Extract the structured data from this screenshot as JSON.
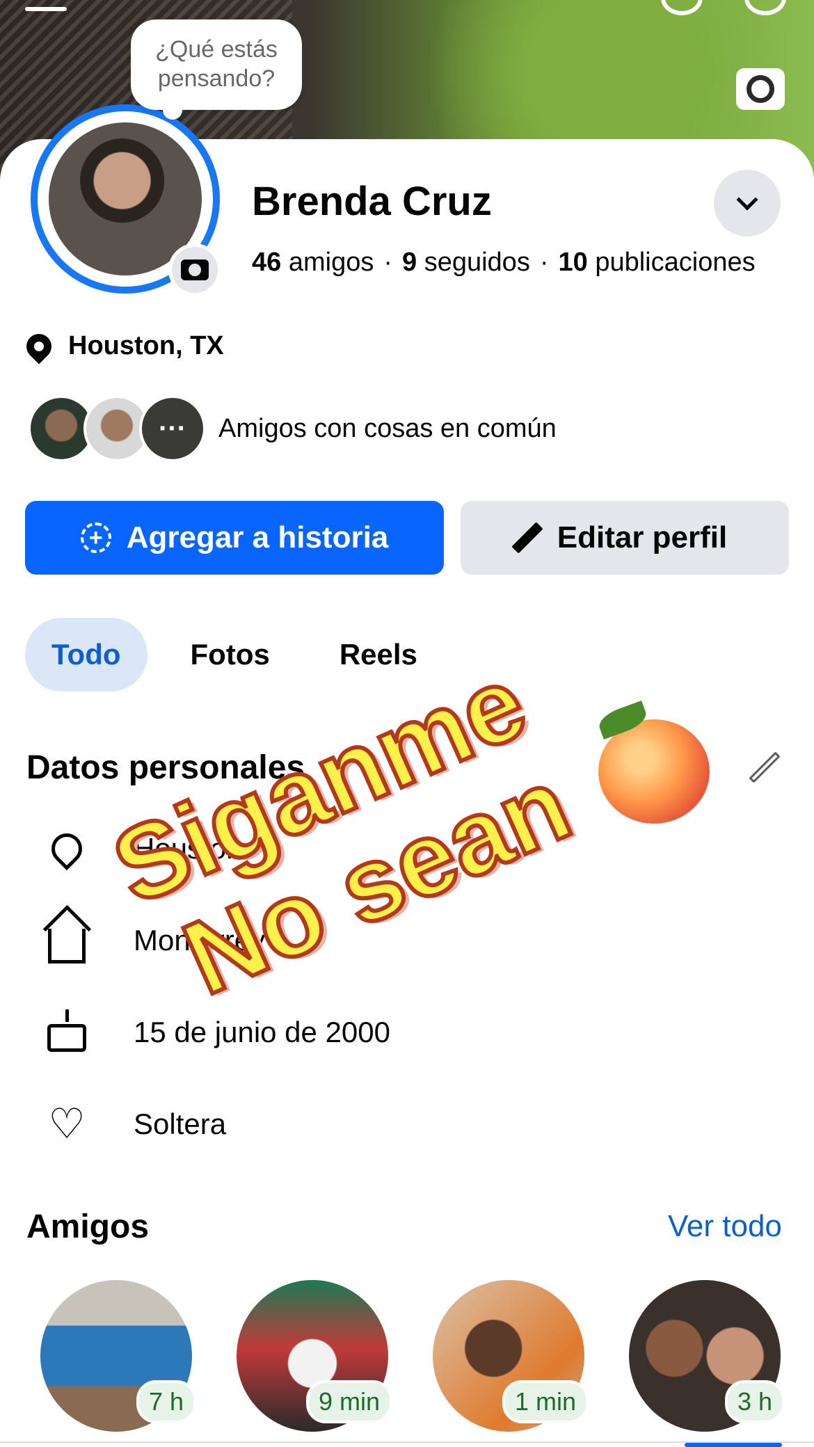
{
  "profile": {
    "thought_prompt": "¿Qué estás pensando?",
    "name": "Brenda Cruz",
    "friends_count": "46",
    "friends_label": "amigos",
    "following_count": "9",
    "following_label": "seguidos",
    "posts_count": "10",
    "posts_label": "publicaciones",
    "location": "Houston, TX",
    "mutual_text": "Amigos con cosas en común",
    "mutual_more": "···"
  },
  "actions": {
    "add_story": "Agregar a historia",
    "edit_profile": "Editar perfil"
  },
  "tabs": [
    {
      "label": "Todo",
      "active": true
    },
    {
      "label": "Fotos",
      "active": false
    },
    {
      "label": "Reels",
      "active": false
    }
  ],
  "personal": {
    "title": "Datos personales",
    "items": [
      {
        "icon": "location-pin-icon",
        "text": "Houston"
      },
      {
        "icon": "home-icon",
        "text": "Monterrey"
      },
      {
        "icon": "birthday-cake-icon",
        "text": "15 de junio de 2000"
      },
      {
        "icon": "heart-icon",
        "text": "Soltera"
      }
    ]
  },
  "friends": {
    "title": "Amigos",
    "see_all": "Ver todo",
    "items": [
      {
        "badge": "7 h"
      },
      {
        "badge": "9 min"
      },
      {
        "badge": "1 min"
      },
      {
        "badge": "3 h"
      }
    ]
  },
  "overlay": {
    "line1": "Siganme",
    "line2": "No sean"
  },
  "colors": {
    "primary": "#0866ff",
    "active_tab_bg": "#dbe7f9",
    "link": "#0b5fd1",
    "button_gray": "#e4e6eb"
  }
}
